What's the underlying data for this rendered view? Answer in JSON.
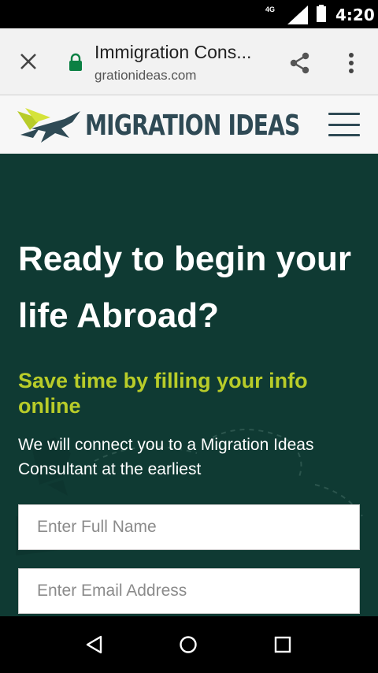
{
  "status_bar": {
    "network": "4G",
    "time": "4:20"
  },
  "browser": {
    "page_title": "Immigration Cons...",
    "url": "grationideas.com"
  },
  "site": {
    "logo_text": "MIGRATION IDEAS"
  },
  "hero": {
    "heading": "Ready to begin your life Abroad?",
    "subheading": "Save time by filling your info online",
    "description": "We will connect you to a Migration Ideas Consultant at the earliest",
    "full_name_placeholder": "Enter Full Name",
    "email_placeholder": "Enter Email Address"
  },
  "colors": {
    "hero_background": "#0f3a33",
    "accent_green": "#b8cc29",
    "brand_navy": "#2f4a55",
    "lock_green": "#0b8043"
  },
  "icons": {
    "close": "close-icon",
    "lock": "lock-icon",
    "share": "share-icon",
    "menu": "more-vert-icon",
    "hamburger": "hamburger-menu-icon",
    "back": "back-triangle-icon",
    "home": "home-circle-icon",
    "recents": "recents-square-icon"
  }
}
